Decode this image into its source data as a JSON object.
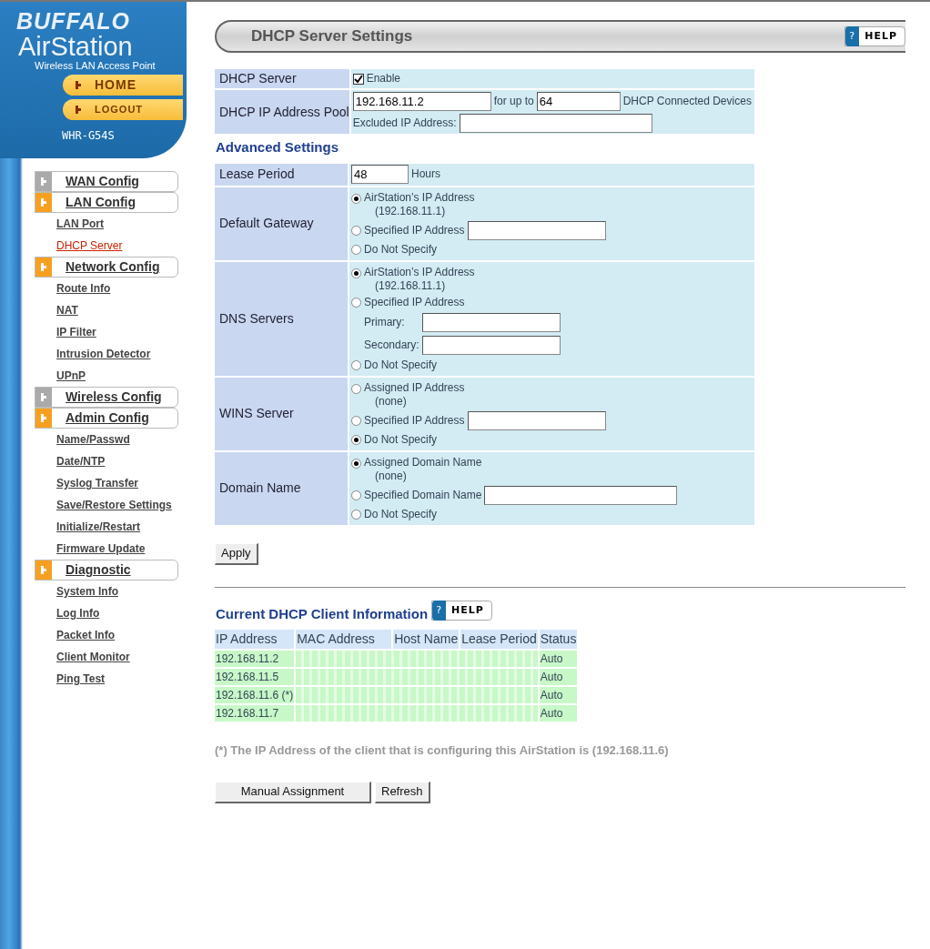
{
  "sidebar": {
    "brand": "BUFFALO",
    "product": "AirStation",
    "tagline": "Wireless LAN Access Point",
    "buttons": [
      "HOME",
      "LOGOUT"
    ],
    "model": "WHR-G54S",
    "sections": [
      {
        "label": "WAN Config",
        "expanded": false
      },
      {
        "label": "LAN Config",
        "expanded": true,
        "children": [
          {
            "label": "LAN Port",
            "selected": false
          },
          {
            "label": "DHCP Server",
            "selected": true
          }
        ]
      },
      {
        "label": "Network Config",
        "expanded": true,
        "children": [
          {
            "label": "Route Info",
            "selected": false
          },
          {
            "label": "NAT",
            "selected": false
          },
          {
            "label": "IP Filter",
            "selected": false
          },
          {
            "label": "Intrusion Detector",
            "selected": false
          },
          {
            "label": "UPnP",
            "selected": false
          }
        ]
      },
      {
        "label": "Wireless Config",
        "expanded": false
      },
      {
        "label": "Admin Config",
        "expanded": true,
        "children": [
          {
            "label": "Name/Passwd",
            "selected": false
          },
          {
            "label": "Date/NTP",
            "selected": false
          },
          {
            "label": "Syslog Transfer",
            "selected": false
          },
          {
            "label": "Save/Restore Settings",
            "selected": false
          },
          {
            "label": "Initialize/Restart",
            "selected": false
          },
          {
            "label": "Firmware Update",
            "selected": false
          }
        ]
      },
      {
        "label": "Diagnostic",
        "expanded": true,
        "children": [
          {
            "label": "System Info",
            "selected": false
          },
          {
            "label": "Log Info",
            "selected": false
          },
          {
            "label": "Packet Info",
            "selected": false
          },
          {
            "label": "Client Monitor",
            "selected": false
          },
          {
            "label": "Ping Test",
            "selected": false
          }
        ]
      }
    ]
  },
  "title": "DHCP Server Settings",
  "help": {
    "icon": "?",
    "label": "HELP"
  },
  "dhcp_server": {
    "label": "DHCP Server",
    "option": "Enable",
    "checked": true
  },
  "address_pool": {
    "label": "DHCP IP Address Pool",
    "start": "192.168.11.2",
    "between": "for up to",
    "count": "64",
    "after": "DHCP Connected Devices",
    "excluded_label": "Excluded IP Address:"
  },
  "advanced_heading": "Advanced Settings",
  "lease": {
    "label": "Lease Period",
    "value": "48",
    "unit": "Hours"
  },
  "options": [
    {
      "label": "Default Gateway",
      "choices": [
        {
          "kind": "detail",
          "label": "AirStation’s IP Address",
          "detail": "(192.168.11.1)",
          "selected": true
        },
        {
          "kind": "field",
          "label": "Specified IP Address",
          "selected": false
        },
        {
          "kind": "plain",
          "label": "Do Not Specify",
          "selected": false
        }
      ]
    },
    {
      "label": "DNS Servers",
      "choices": [
        {
          "kind": "detail",
          "label": "AirStation’s IP Address",
          "detail": "(192.168.11.1)",
          "selected": true
        },
        {
          "kind": "fields",
          "label": "Specified IP Address",
          "fields": [
            "Primary:",
            "Secondary:"
          ],
          "selected": false
        },
        {
          "kind": "plain",
          "label": "Do Not Specify",
          "selected": false
        }
      ]
    },
    {
      "label": "WINS Server",
      "choices": [
        {
          "kind": "detail",
          "label": "Assigned IP Address",
          "detail": "(none)",
          "selected": false
        },
        {
          "kind": "field",
          "label": "Specified IP Address",
          "selected": false
        },
        {
          "kind": "plain",
          "label": "Do Not Specify",
          "selected": true
        }
      ]
    },
    {
      "label": "Domain Name",
      "choices": [
        {
          "kind": "detail",
          "label": "Assigned Domain Name",
          "detail": "(none)",
          "selected": true
        },
        {
          "kind": "field",
          "label": "Specified Domain Name",
          "selected": false
        },
        {
          "kind": "plain",
          "label": "Do Not Specify",
          "selected": false
        }
      ]
    }
  ],
  "apply": "Apply",
  "clients": {
    "heading": "Current DHCP Client Information",
    "help": {
      "icon": "?",
      "label": "HELP"
    },
    "columns": [
      "IP Address",
      "MAC Address",
      "Host Name",
      "Lease Period",
      "Status"
    ],
    "rows": [
      {
        "ip": "192.168.11.2",
        "status": "Auto"
      },
      {
        "ip": "192.168.11.5",
        "status": "Auto"
      },
      {
        "ip": "192.168.11.6 (*)",
        "status": "Auto"
      },
      {
        "ip": "192.168.11.7",
        "status": "Auto"
      }
    ]
  },
  "footnote": "(*) The IP Address of the client that is configuring this AirStation is (192.168.11.6)",
  "buttons": [
    "Manual Assignment",
    "Refresh"
  ]
}
